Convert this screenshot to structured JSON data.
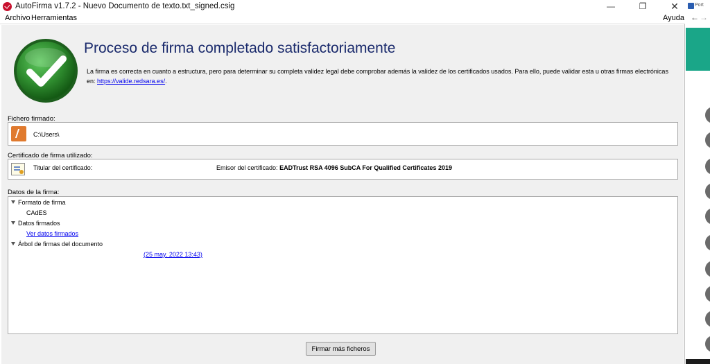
{
  "window": {
    "title": "AutoFirma v1.7.2 - Nuevo Documento de texto.txt_signed.csig",
    "minimize_glyph": "—",
    "maximize_glyph": "❐",
    "close_glyph": "✕"
  },
  "menu": {
    "archivo": "Archivo",
    "herramientas": "Herramientas",
    "ayuda": "Ayuda"
  },
  "result": {
    "headline": "Proceso de firma completado satisfactoriamente",
    "info_text": "La firma es correcta en cuanto a estructura, pero para determinar su completa validez legal debe comprobar además la validez de los certificados usados. Para ello, puede validar esta u otras firmas electrónicas en: ",
    "info_link": "https://valide.redsara.es/",
    "info_suffix": ".",
    "icon": "check-circle-icon",
    "icon_color": "#2e8b2e"
  },
  "file": {
    "label": "Fichero firmado:",
    "path": "C:\\Users\\",
    "icon": "autofirma-file-icon"
  },
  "certificate": {
    "label": "Certificado de firma utilizado:",
    "holder_label": "Titular del certificado:",
    "issuer_label": "Emisor del certificado:",
    "issuer_value": "EADTrust RSA 4096 SubCA For Qualified Certificates 2019",
    "icon": "certificate-icon"
  },
  "signature_data": {
    "label": "Datos de la firma:",
    "format_title": "Formato de firma",
    "format_value": "CAdES",
    "signed_data_title": "Datos firmados",
    "signed_data_link": "Ver datos firmados",
    "tree_title": "Árbol de firmas del documento",
    "tree_entry": "(25 may. 2022 13:43)"
  },
  "buttons": {
    "sign_more": "Firmar más ficheros"
  },
  "background_window": {
    "tab_label": "Port",
    "back_glyph": "←",
    "forward_glyph": "→",
    "banner_color": "#1aa688"
  }
}
